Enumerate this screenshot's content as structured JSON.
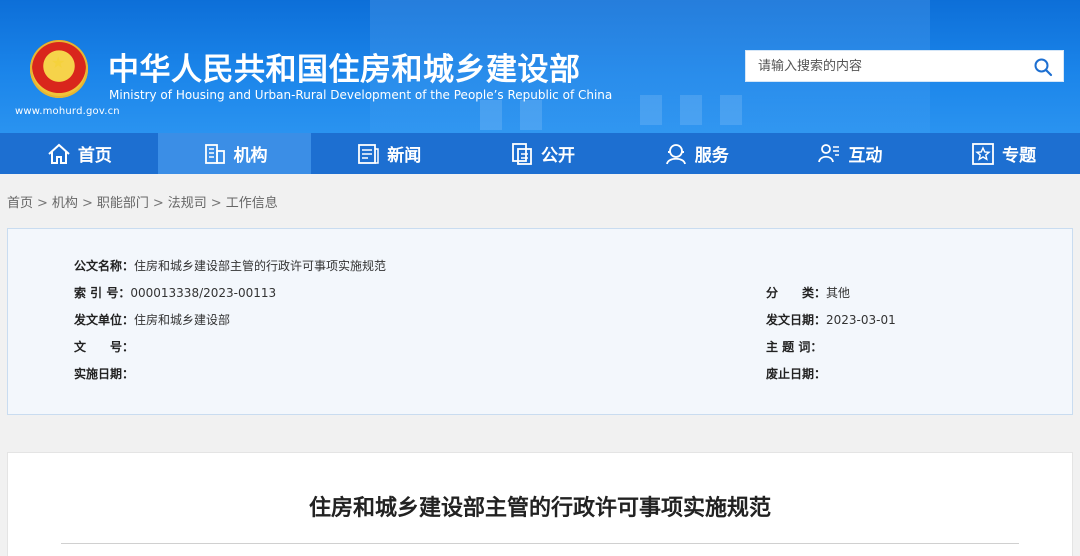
{
  "header": {
    "title_cn": "中华人民共和国住房和城乡建设部",
    "title_en": "Ministry of Housing and Urban-Rural Development of the People’s Republic of China",
    "url": "www.mohurd.gov.cn",
    "search_placeholder": "请输入搜索的内容"
  },
  "nav": {
    "items": [
      {
        "label": "首页",
        "icon": "home-icon"
      },
      {
        "label": "机构",
        "icon": "building-icon"
      },
      {
        "label": "新闻",
        "icon": "newspaper-icon"
      },
      {
        "label": "公开",
        "icon": "document-icon"
      },
      {
        "label": "服务",
        "icon": "service-icon"
      },
      {
        "label": "互动",
        "icon": "chat-icon"
      },
      {
        "label": "专题",
        "icon": "star-icon"
      }
    ],
    "active_index": 1
  },
  "breadcrumb": [
    "首页",
    "机构",
    "职能部门",
    "法规司",
    "工作信息"
  ],
  "info": {
    "doc_name_label": "公文名称：",
    "doc_name_value": "住房和城乡建设部主管的行政许可事项实施规范",
    "index_label": "索 引 号：",
    "index_value": "000013338/2023-00113",
    "category_label": "分　　类：",
    "category_value": "其他",
    "issuer_label": "发文单位：",
    "issuer_value": "住房和城乡建设部",
    "date_label": "发文日期：",
    "date_value": "2023-03-01",
    "docno_label": "文　　号：",
    "docno_value": "",
    "keywords_label": "主 题 词：",
    "keywords_value": "",
    "effective_label": "实施日期：",
    "effective_value": "",
    "expiry_label": "废止日期：",
    "expiry_value": ""
  },
  "article": {
    "title": "住房和城乡建设部主管的行政许可事项实施规范"
  },
  "colors": {
    "header_blue": "#1b85ea",
    "nav_blue": "#1d6fd1",
    "nav_active": "#3b8ee6"
  }
}
